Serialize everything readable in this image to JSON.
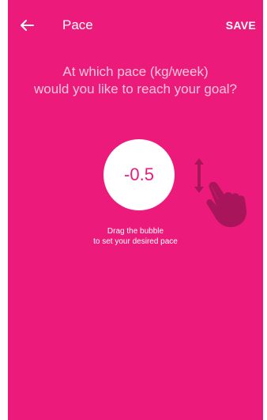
{
  "toolbar": {
    "back_icon": "arrow-left-icon",
    "title": "Pace",
    "save_label": "SAVE"
  },
  "question": {
    "line1": "At which pace (kg/week)",
    "line2": "would you like to reach your goal?"
  },
  "bubble": {
    "value": "-0.5"
  },
  "hint": {
    "icon": "hand-drag-up-down-icon",
    "line1": "Drag the bubble",
    "line2": "to set your desired pace"
  },
  "colors": {
    "background": "#ec1b7b",
    "bubble": "#ffffff",
    "question_text": "#f9c6de",
    "hand_icon": "#a8155a"
  }
}
